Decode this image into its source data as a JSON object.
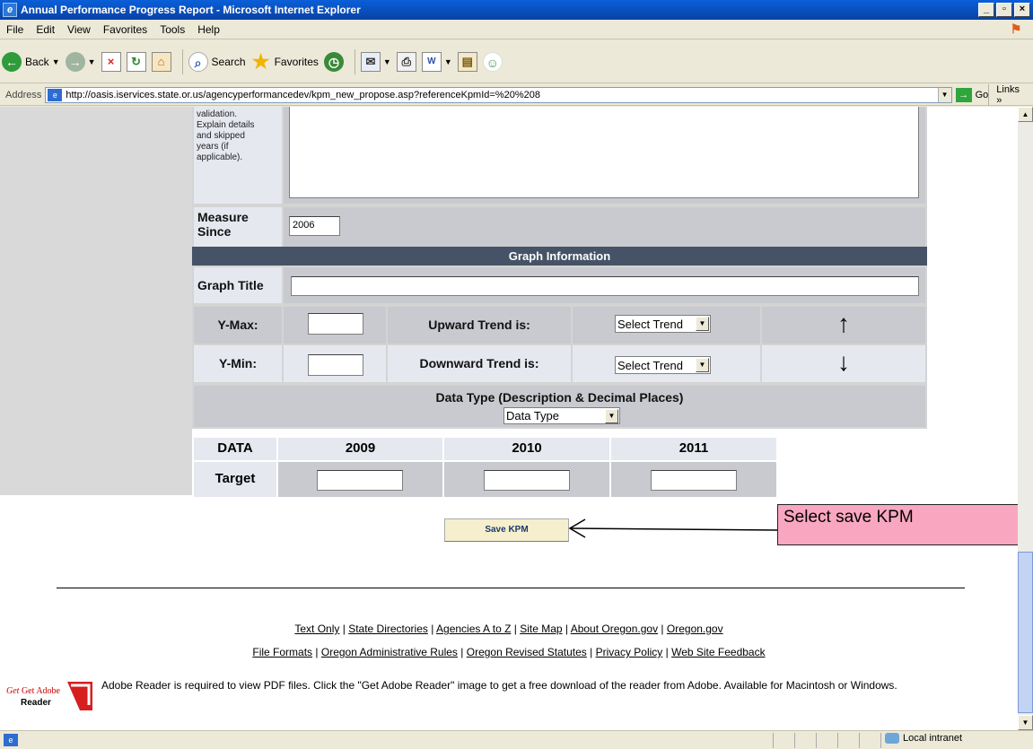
{
  "window": {
    "title": "Annual Performance Progress Report - Microsoft Internet Explorer",
    "buttons": [
      "_",
      "æ",
      "X"
    ]
  },
  "menu": [
    "File",
    "Edit",
    "View",
    "Favorites",
    "Tools",
    "Help"
  ],
  "toolbar": {
    "back": "Back",
    "search": "Search",
    "favorites": "Favorites"
  },
  "address": {
    "label": "Address",
    "url": "http://oasis.iservices.state.or.us/agencyperformancedev/kpm_new_propose.asp?referenceKpmId=%20%208",
    "go": "Go",
    "links": "Links"
  },
  "form": {
    "validation_text": [
      "validation.",
      "Explain details",
      "and skipped",
      "years (if",
      "applicable)."
    ],
    "measure_since_label": "Measure Since",
    "measure_since_value": "2006",
    "graph_section_title": "Graph Information",
    "graph_title_label": "Graph Title",
    "graph_title_value": "",
    "ymax_label": "Y-Max:",
    "ymin_label": "Y-Min:",
    "upward_label": "Upward Trend is:",
    "downward_label": "Downward Trend is:",
    "select_trend": "Select Trend",
    "up_arrow": "↑",
    "down_arrow": "↓",
    "data_type_label": "Data Type (Description & Decimal Places)",
    "data_type_select": "Data Type"
  },
  "data_table": {
    "header_label": "DATA",
    "years": [
      "2009",
      "2010",
      "2011"
    ],
    "row_label": "Target"
  },
  "save_button": "Save KPM",
  "callout": "Select save KPM",
  "footer": {
    "row1": [
      "Text Only",
      "State Directories",
      "Agencies A to Z",
      "Site Map",
      "About Oregon.gov",
      "Oregon.gov"
    ],
    "row2": [
      "File Formats",
      "Oregon Administrative Rules",
      "Oregon Revised Statutes",
      "Privacy Policy",
      "Web Site Feedback"
    ],
    "adobe_logo": [
      "Get Adobe",
      "Reader"
    ],
    "adobe_text": "Adobe Reader is required to view PDF files. Click the \"Get Adobe Reader\" image to get a free download of the reader from Adobe. Available for Macintosh or Windows."
  },
  "status": {
    "zone": "Local intranet"
  }
}
